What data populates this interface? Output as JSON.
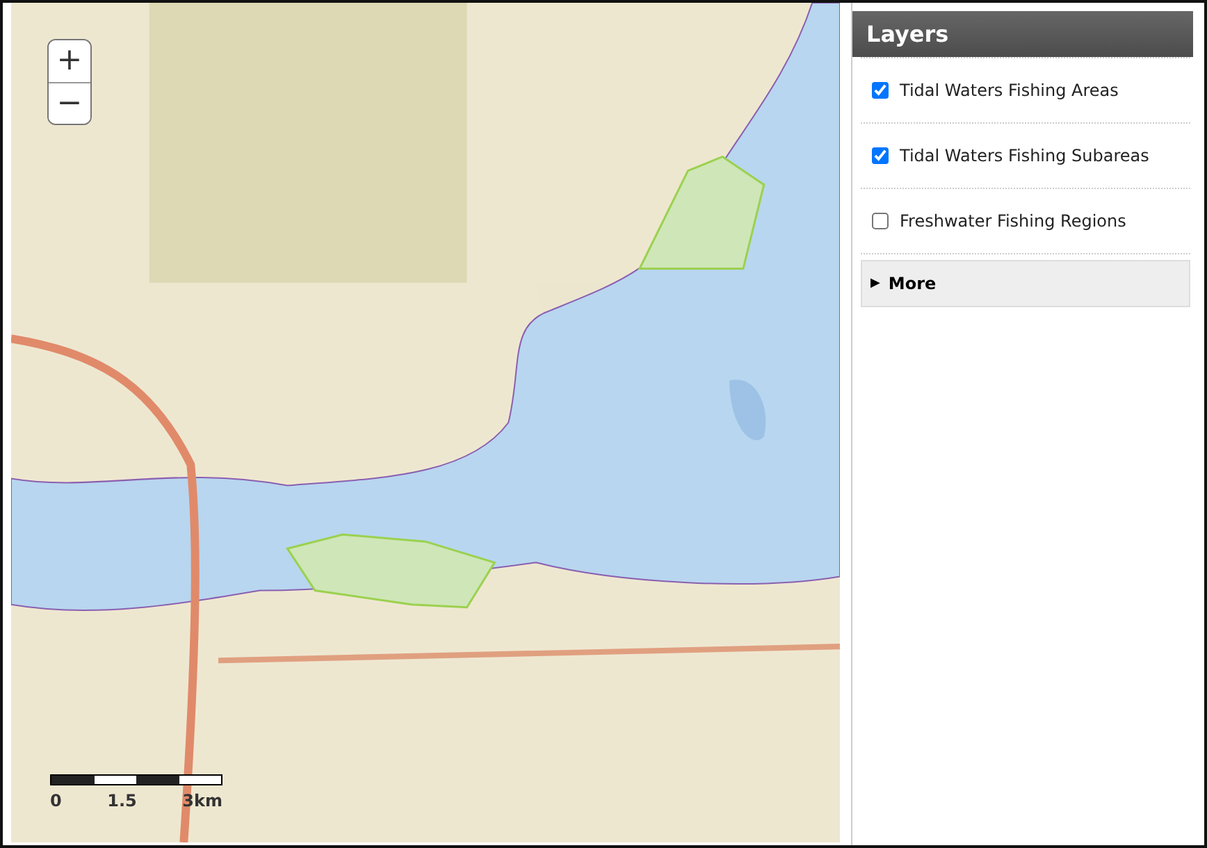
{
  "map": {
    "zoom_in": "+",
    "zoom_out": "−",
    "scale_bar": {
      "labels": [
        "0",
        "1.5",
        "3km"
      ]
    }
  },
  "layers_panel": {
    "title": "Layers",
    "layers": [
      {
        "label": "Tidal Waters Fishing Areas",
        "checked": true
      },
      {
        "label": "Tidal Waters Fishing Subareas",
        "checked": true
      },
      {
        "label": "Freshwater Fishing Regions",
        "checked": false
      }
    ],
    "more": {
      "arrow": "▶",
      "label": "More",
      "expanded": false
    }
  }
}
